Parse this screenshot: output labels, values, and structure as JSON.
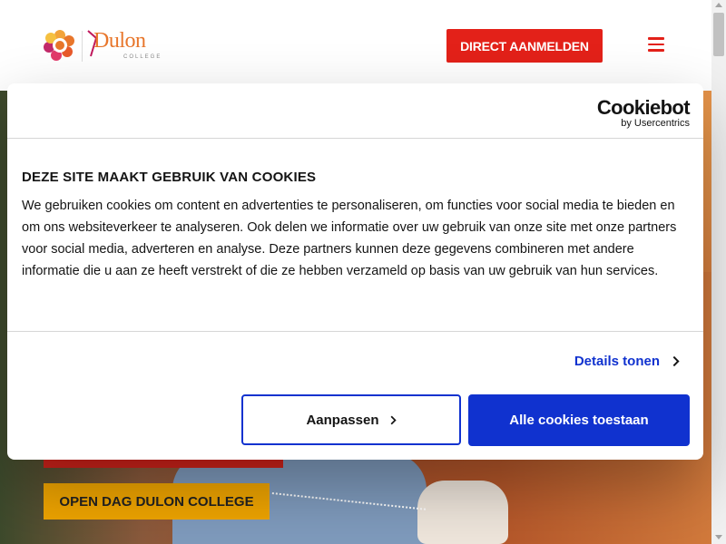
{
  "header": {
    "logo_text": "Dulon",
    "logo_subtext": "COLLEGE",
    "cta_label": "DIRECT AANMELDEN",
    "menu_icon": "hamburger-menu-icon"
  },
  "hero": {
    "open_day_label": "OPEN DAG DULON COLLEGE"
  },
  "cookie_dialog": {
    "brand_name": "Cookiebot",
    "brand_sub": "by Usercentrics",
    "title": "DEZE SITE MAAKT GEBRUIK VAN COOKIES",
    "body": "We gebruiken cookies om content en advertenties te personaliseren, om functies voor social media te bieden en om ons websiteverkeer te analyseren. Ook delen we informatie over uw gebruik van onze site met onze partners voor social media, adverteren en analyse. Deze partners kunnen deze gegevens combineren met andere informatie die u aan ze heeft verstrekt of die ze hebben verzameld op basis van uw gebruik van hun services.",
    "details_label": "Details tonen",
    "customize_label": "Aanpassen",
    "allow_all_label": "Alle cookies toestaan"
  },
  "colors": {
    "primary_red": "#e32119",
    "cookiebot_blue": "#1032cf",
    "yellow": "#f0a500"
  }
}
